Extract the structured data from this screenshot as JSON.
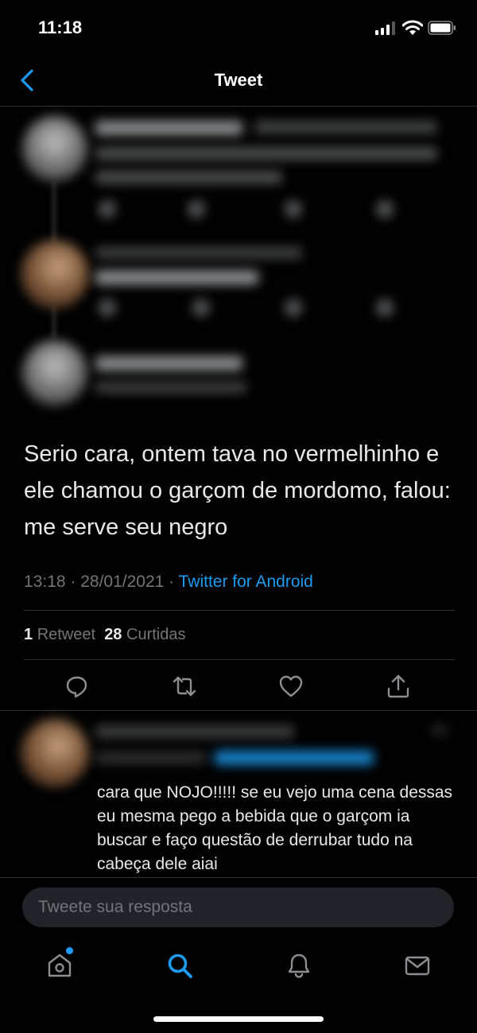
{
  "status_bar": {
    "time": "11:18"
  },
  "header": {
    "title": "Tweet"
  },
  "main_tweet": {
    "text": "Serio cara, ontem tava no vermelhinho e ele chamou o garçom de mordomo, falou: me serve seu negro",
    "time": "13:18 · 28/01/2021 · ",
    "source": "Twitter for Android",
    "retweets_count": "1",
    "retweets_label": "Retweet",
    "likes_count": "28",
    "likes_label": "Curtidas"
  },
  "reply": {
    "text": "cara que NOJO!!!!! se eu vejo uma cena dessas eu mesma pego a bebida que o garçom ia buscar e faço questão de derrubar tudo na cabeça dele aiai"
  },
  "compose": {
    "placeholder": "Tweete sua resposta"
  },
  "colors": {
    "accent": "#1d9bf0",
    "background": "#000000",
    "muted": "#71767b"
  },
  "icons": [
    "back-chevron-icon",
    "reply-icon",
    "retweet-icon",
    "like-icon",
    "share-icon",
    "home-icon",
    "search-icon",
    "notifications-icon",
    "messages-icon"
  ]
}
